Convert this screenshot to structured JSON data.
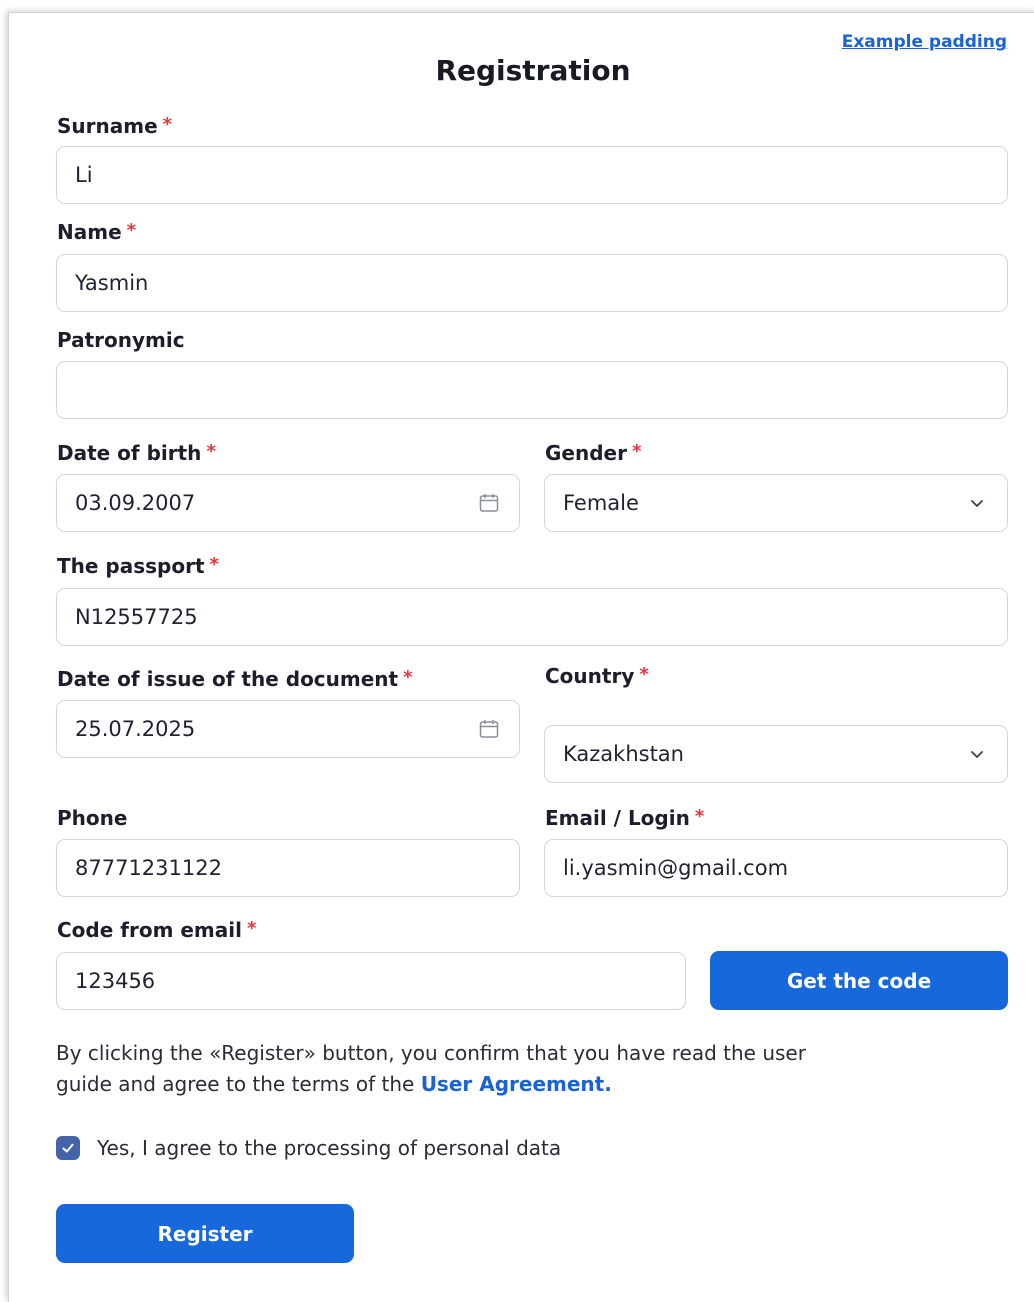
{
  "header": {
    "top_link": "Example padding",
    "title": "Registration"
  },
  "required_marker": "*",
  "form": {
    "surname": {
      "label": "Surname",
      "value": "Li"
    },
    "name": {
      "label": "Name",
      "value": "Yasmin"
    },
    "patronymic": {
      "label": "Patronymic",
      "value": ""
    },
    "dob": {
      "label": "Date of birth",
      "value": "03.09.2007",
      "icon": "calendar-icon"
    },
    "gender": {
      "label": "Gender",
      "value": "Female",
      "icon": "chevron-down-icon"
    },
    "passport": {
      "label": "The passport",
      "value": "N12557725"
    },
    "issue_date": {
      "label": "Date of issue of the document",
      "value": "25.07.2025",
      "icon": "calendar-icon"
    },
    "country": {
      "label": "Country",
      "value": "Kazakhstan",
      "icon": "chevron-down-icon"
    },
    "phone": {
      "label": "Phone",
      "value": "87771231122"
    },
    "email": {
      "label": "Email / Login",
      "value": "li.yasmin@gmail.com"
    },
    "code": {
      "label": "Code from email",
      "value": "123456"
    },
    "get_code_button": "Get the code"
  },
  "terms": {
    "text": "By clicking the «Register» button, you confirm that you have read the user guide and agree to the terms of the ",
    "link": "User Agreement."
  },
  "consent": {
    "checked": true,
    "label": "Yes, I agree to the processing of personal data"
  },
  "register_button": "Register",
  "colors": {
    "accent": "#1668dc",
    "link": "#1a63d6",
    "required": "#e8333a",
    "checkbox": "#4564a8",
    "border": "#d3d6dd"
  }
}
